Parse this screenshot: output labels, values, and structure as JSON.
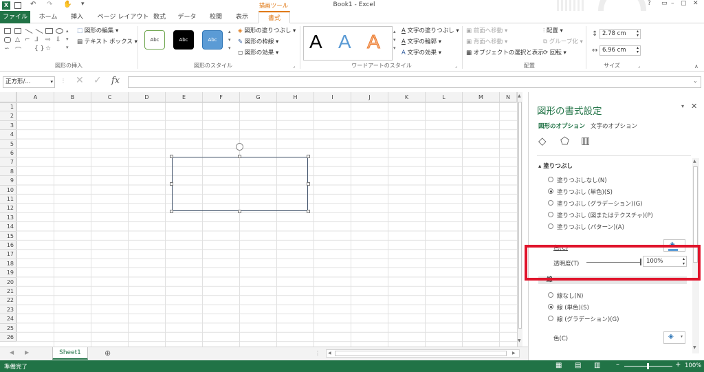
{
  "title": {
    "doc": "Book1 - Excel",
    "tool_context": "描画ツール",
    "window_controls": [
      "?",
      "▭",
      "–",
      "▢",
      "✕"
    ]
  },
  "tabs": [
    {
      "label": "ファイル",
      "active": false,
      "file": true
    },
    {
      "label": "ホーム"
    },
    {
      "label": "挿入"
    },
    {
      "label": "ページ レイアウト"
    },
    {
      "label": "数式"
    },
    {
      "label": "データ"
    },
    {
      "label": "校閲"
    },
    {
      "label": "表示"
    },
    {
      "label": "書式",
      "active": true
    }
  ],
  "ribbon": {
    "insert_shapes": {
      "label": "図形の挿入",
      "edit_shape": "図形の編集",
      "text_box": "テキスト ボックス"
    },
    "shape_styles": {
      "label": "図形のスタイル",
      "samples": [
        "Abc",
        "Abc",
        "Abc"
      ],
      "fill": "図形の塗りつぶし",
      "outline": "図形の枠線",
      "effects": "図形の効果"
    },
    "wordart": {
      "label": "ワードアートのスタイル",
      "letters": [
        "A",
        "A",
        "A"
      ],
      "text_fill": "文字の塗りつぶし",
      "text_outline": "文字の輪郭",
      "text_effects": "文字の効果"
    },
    "arrange": {
      "label": "配置",
      "bring_forward": "前面へ移動",
      "send_backward": "背面へ移動",
      "selection_pane": "オブジェクトの選択と表示",
      "align": "配置",
      "group": "グループ化",
      "rotate": "回転"
    },
    "size": {
      "label": "サイズ",
      "height": "2.78 cm",
      "width": "6.96 cm"
    }
  },
  "formula_bar": {
    "name_box": "正方形/...",
    "fx": "fx",
    "value": ""
  },
  "sheet": {
    "columns": [
      "A",
      "B",
      "C",
      "D",
      "E",
      "F",
      "G",
      "H",
      "I",
      "J",
      "K",
      "L",
      "M",
      "N"
    ],
    "rows": [
      "1",
      "2",
      "3",
      "4",
      "5",
      "6",
      "7",
      "8",
      "9",
      "10",
      "11",
      "12",
      "13",
      "14",
      "15",
      "16",
      "17",
      "18",
      "19",
      "20",
      "21",
      "22",
      "23",
      "24",
      "25",
      "26"
    ]
  },
  "sheet_tabs": {
    "active": "Sheet1",
    "add": "⊕"
  },
  "status": {
    "ready": "準備完了",
    "zoom": "100%"
  },
  "pane": {
    "title": "図形の書式設定",
    "tab_shape": "図形のオプション",
    "tab_text": "文字のオプション",
    "fill_section": "塗りつぶし",
    "fill_options": [
      {
        "label": "塗りつぶしなし(N)",
        "checked": false
      },
      {
        "label": "塗りつぶし (単色)(S)",
        "checked": true
      },
      {
        "label": "塗りつぶし (グラデーション)(G)",
        "checked": false
      },
      {
        "label": "塗りつぶし (図またはテクスチャ)(P)",
        "checked": false
      },
      {
        "label": "塗りつぶし (パターン)(A)",
        "checked": false
      }
    ],
    "color_label": "色(C)",
    "transparency_label": "透明度(T)",
    "transparency_value": "100%",
    "transparency_fraction": 1.0,
    "line_section": "線",
    "line_options": [
      {
        "label": "線なし(N)",
        "checked": false
      },
      {
        "label": "線 (単色)(S)",
        "checked": true
      },
      {
        "label": "線 (グラデーション)(G)",
        "checked": false
      }
    ],
    "line_color_label": "色(C)"
  },
  "colors": {
    "excel_green": "#217346",
    "highlight": "#e0142b",
    "tool_tab": "#e07a18"
  }
}
